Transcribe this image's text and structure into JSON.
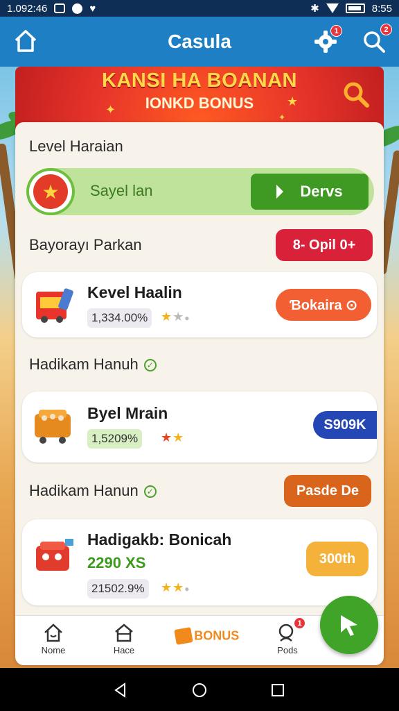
{
  "status_bar": {
    "time": "1.092:46",
    "clock": "8:55"
  },
  "app_bar": {
    "title": "Casula",
    "settings_badge": "1",
    "search_badge": "2"
  },
  "banner": {
    "headline": "KANSI HA BOANAN",
    "subhead": "IONKD BONUS"
  },
  "level": {
    "title": "Level Haraian",
    "progress_label": "Sayel lan",
    "progress_button": "Dervs"
  },
  "section_1": {
    "label": "Bayorayı Parkan",
    "pill": "8- Opil 0+"
  },
  "items": [
    {
      "name": "Kevel Haalin",
      "value": "1,334.00%",
      "button": "Ɓokaira ⊙",
      "stars_filled": 1,
      "stars_total": 3
    },
    {
      "name": "Byel Mrain",
      "value": "1,5209%",
      "button": "S909K",
      "stars_filled": 2,
      "stars_total": 2
    },
    {
      "name": "Hadigakb: Bonicah",
      "subvalue": "2290 XS",
      "value": "21502.9%",
      "button": "300th",
      "stars_filled": 2,
      "stars_total": 3
    }
  ],
  "section_2": {
    "label": "Hadikam Hanuh"
  },
  "section_3": {
    "label": "Hadikam Hanun",
    "pill": "Pasde De"
  },
  "bottom_nav": {
    "items": [
      {
        "label": "Nome"
      },
      {
        "label": "Hace"
      },
      {
        "label": "BONUS"
      },
      {
        "label": "Pods",
        "badge": "1"
      }
    ]
  },
  "colors": {
    "app_bar": "#1f7fc4",
    "accent_green": "#3f9a24",
    "accent_red": "#d9213a",
    "accent_orange": "#e8591f"
  }
}
